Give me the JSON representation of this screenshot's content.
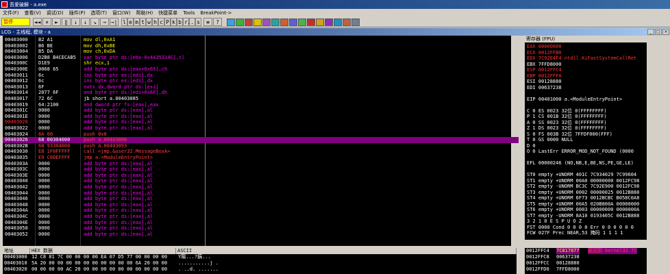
{
  "window": {
    "title": "吾爱破解 - a.exe"
  },
  "menu": [
    "文件(F)",
    "查看(V)",
    "调试(D)",
    "插件(P)",
    "选项(T)",
    "窗口(W)",
    "帮助(H)",
    "快捷菜单",
    "Tools",
    "BreakPoint->"
  ],
  "toolbar": {
    "state": "暂停",
    "nav_buttons": [
      "◄◄",
      "×",
      "►",
      "‖",
      "↓",
      "↓",
      "↘",
      "→",
      "→|"
    ],
    "letter_buttons": [
      "l",
      "e",
      "m",
      "t",
      "w",
      "h",
      "c",
      "P",
      "k",
      "b",
      "r",
      "...",
      "s"
    ],
    "misc_buttons": [
      "≡",
      "?"
    ],
    "color_buttons": [
      "#3aa0e0",
      "#40b040",
      "#c04040",
      "#e0c000",
      "#a050c0",
      "#30a0a0",
      "#d06030",
      "#6060d0",
      "#50b050",
      "#c03030",
      "#d0a020",
      "#9030b0",
      "#2090c0",
      "#c06040",
      "#708090"
    ]
  },
  "cpu_window": {
    "title": "LCG - 主线程, 模块 - a"
  },
  "colors": {
    "bg": "#000000",
    "selected_row": "#800080",
    "op_mov": "#ffff00",
    "op_arith": "#ffff00",
    "op_ptr": "#ff00ff",
    "op_call": "#ff4040",
    "red": "#ff3030"
  },
  "disasm": [
    {
      "addr": "00403000",
      "hex": "B2 A1",
      "asm": "mov dl,0xA1",
      "kind": "mov"
    },
    {
      "addr": "00403002",
      "hex": "B6 BE",
      "asm": "mov dh,0xBE",
      "kind": "mov"
    },
    {
      "addr": "00403004",
      "hex": "B5 DA",
      "asm": "mov ch,0xDA",
      "kind": "mov"
    },
    {
      "addr": "00403006",
      "hex": "D2B8 B4CECAB5",
      "asm": "sar byte ptr ds:[ebx-0x4A35314C],cl",
      "kind": "ptr"
    },
    {
      "addr": "0040300C",
      "hex": "D1E9",
      "asm": "shr ecx,1",
      "kind": "mov"
    },
    {
      "addr": "0040300E",
      "hex": "0068 65",
      "asm": "add byte ptr ds:[eax+0x65],ch",
      "kind": "ptr"
    },
    {
      "addr": "00403011",
      "hex": "6c",
      "asm": "ins byte ptr es:[edi],dx",
      "kind": "ptr"
    },
    {
      "addr": "00403012",
      "hex": "6c",
      "asm": "ins byte ptr es:[edi],dx",
      "kind": "ptr"
    },
    {
      "addr": "00403013",
      "hex": "6F",
      "asm": "outs dx,dword ptr ds:[esi]",
      "kind": "ptr"
    },
    {
      "addr": "00403014",
      "hex": "2077 6F",
      "asm": "and byte ptr ds:[edi+0x6F],dh",
      "kind": "ptr"
    },
    {
      "addr": "00403017",
      "hex": "72 6C",
      "asm": "jb short a.00403085",
      "kind": "jmp"
    },
    {
      "addr": "00403019",
      "hex": "64:2100",
      "asm": "and dword ptr fs:[eax],eax",
      "kind": "ptr"
    },
    {
      "addr": "0040301C",
      "hex": "0000",
      "asm": "add byte ptr ds:[eax],al",
      "kind": "ptr"
    },
    {
      "addr": "0040301E",
      "hex": "0000",
      "asm": "add byte ptr ds:[eax],al",
      "kind": "ptr"
    },
    {
      "addr": "00403020",
      "hex": "0000",
      "asm": "add byte ptr ds:[eax],al",
      "kind": "ptr",
      "addr_red": true
    },
    {
      "addr": "00403022",
      "hex": "0000",
      "asm": "add byte ptr ds:[eax],al",
      "kind": "ptr"
    },
    {
      "addr": "00403024",
      "hex": "6A 00",
      "asm": "push 0x0",
      "kind": "call"
    },
    {
      "addr": "00403026",
      "hex": "68 00304000",
      "asm": "push a.00403000",
      "kind": "call",
      "selected": true
    },
    {
      "addr": "0040302B",
      "hex": "68 93304000",
      "asm": "push a.00403093",
      "kind": "call"
    },
    {
      "addr": "00403030",
      "hex": "E8 1F0FFFFF",
      "asm": "call <jmp.&user32.MessageBoxA>",
      "kind": "call"
    },
    {
      "addr": "00403035",
      "hex": "E9 C6DEFFFF",
      "asm": "jmp a.<ModuleEntryPoint>",
      "kind": "call"
    },
    {
      "addr": "0040303A",
      "hex": "0000",
      "asm": "add byte ptr ds:[eax],al",
      "kind": "ptr"
    },
    {
      "addr": "0040303C",
      "hex": "0000",
      "asm": "add byte ptr ds:[eax],al",
      "kind": "ptr"
    },
    {
      "addr": "0040303E",
      "hex": "0000",
      "asm": "add byte ptr ds:[eax],al",
      "kind": "ptr"
    },
    {
      "addr": "00403040",
      "hex": "0000",
      "asm": "add byte ptr ds:[eax],al",
      "kind": "ptr"
    },
    {
      "addr": "00403042",
      "hex": "0000",
      "asm": "add byte ptr ds:[eax],al",
      "kind": "ptr"
    },
    {
      "addr": "00403044",
      "hex": "0000",
      "asm": "add byte ptr ds:[eax],al",
      "kind": "ptr"
    },
    {
      "addr": "00403046",
      "hex": "0000",
      "asm": "add byte ptr ds:[eax],al",
      "kind": "ptr"
    },
    {
      "addr": "00403048",
      "hex": "0000",
      "asm": "add byte ptr ds:[eax],al",
      "kind": "ptr"
    },
    {
      "addr": "0040304A",
      "hex": "0000",
      "asm": "add byte ptr ds:[eax],al",
      "kind": "ptr"
    },
    {
      "addr": "0040304C",
      "hex": "0000",
      "asm": "add byte ptr ds:[eax],al",
      "kind": "ptr"
    },
    {
      "addr": "0040304E",
      "hex": "0000",
      "asm": "add byte ptr ds:[eax],al",
      "kind": "ptr"
    },
    {
      "addr": "00403050",
      "hex": "0000",
      "asm": "add byte ptr ds:[eax],al",
      "kind": "ptr"
    },
    {
      "addr": "00403052",
      "hex": "0000",
      "asm": "add byte ptr ds:[eax],al",
      "kind": "ptr"
    }
  ],
  "registers": {
    "title": "寄存器 (FPU)",
    "lines": [
      {
        "t": "EAX 00000000",
        "c": "#ff3030"
      },
      {
        "t": "ECX 0012FFB0",
        "c": "#ff3030"
      },
      {
        "t": "EDX 7C92E4F4 ntdll.KiFastSystemCallRet",
        "c": "#ff3030"
      },
      {
        "t": "EBX 7FFD8000",
        "c": "#ffffff"
      },
      {
        "t": "ESP 0012FFC4",
        "c": "#ff3030"
      },
      {
        "t": "EBP 0012FFF0",
        "c": "#ff3030"
      },
      {
        "t": "ESI 00128880",
        "c": "#ffffff"
      },
      {
        "t": "EDI 00637238",
        "c": "#ffffff"
      },
      {
        "t": "",
        "c": "#ffffff"
      },
      {
        "t": "EIP 00401000 a.<ModuleEntryPoint>",
        "c": "#ffffff"
      },
      {
        "t": "",
        "c": "#ffffff"
      },
      {
        "t": "C 0  ES 0023 32位 0(FFFFFFFF)",
        "c": "#ffffff"
      },
      {
        "t": "P 1  CS 001B 32位 0(FFFFFFFF)",
        "c": "#ffffff"
      },
      {
        "t": "A 0  SS 0023 32位 0(FFFFFFFF)",
        "c": "#ffffff"
      },
      {
        "t": "Z 1  DS 0023 32位 0(FFFFFFFF)",
        "c": "#ffffff"
      },
      {
        "t": "S 0  FS 003B 32位 7FFDF000(FFF)",
        "c": "#ffffff"
      },
      {
        "t": "T 0  GS 0000 NULL",
        "c": "#ffffff"
      },
      {
        "t": "D 0",
        "c": "#ffffff"
      },
      {
        "t": "O 0  LastErr ERROR_MOD_NOT_FOUND (0000",
        "c": "#ffffff"
      },
      {
        "t": "",
        "c": "#ffffff"
      },
      {
        "t": "EFL 00000246 (NO,NB,E,BE,NS,PE,GE,LE)",
        "c": "#ffffff"
      },
      {
        "t": "",
        "c": "#ffffff"
      },
      {
        "t": "ST0 empty +UNORM 401C 7C934029 7C99604",
        "c": "#ffffff"
      },
      {
        "t": "ST1 empty +UNORM 00A0 00000000 0012FC98",
        "c": "#ffffff"
      },
      {
        "t": "ST2 empty -UNORM BC3C 7C92E900 0012FC98",
        "c": "#ffffff"
      },
      {
        "t": "ST3 empty +UNORM 0002 00000025 0012B888",
        "c": "#ffffff"
      },
      {
        "t": "ST4 empty +UNORM 6F73 0012BCBC B058C0A8",
        "c": "#ffffff"
      },
      {
        "t": "ST5 empty +UNORM 00A5 020B800A 00000000",
        "c": "#ffffff"
      },
      {
        "t": "ST6 empty +UNORM 0003 00000000 0000000A",
        "c": "#ffffff"
      },
      {
        "t": "ST7 empty -UNORM 8A10 0193405C 0012B888",
        "c": "#ffffff"
      },
      {
        "t": "               3 2 1 0     E S P U O Z",
        "c": "#ffffff"
      },
      {
        "t": "FST 0000  Cond 0 0 0 0  Err 0 0 0 0 0 0",
        "c": "#ffffff"
      },
      {
        "t": "FCW 027F  Prec NEAR,53  掩码   1 1 1 1",
        "c": "#ffffff"
      }
    ]
  },
  "dump": {
    "headers": [
      "地址",
      "HEX 数据",
      "ASCII"
    ],
    "rows": [
      {
        "addr": "00403000",
        "hex": "12 C8 81 7C 00 00 00 00 EA 07 D5 77 00 00 00 00",
        "ascii": "Ÿ陽...?鎬..."
      },
      {
        "addr": "00403010",
        "hex": "5A 20 00 00 00 00 00 00 00 00 00 00 6A 20 00 00",
        "ascii": "...........j ."
      },
      {
        "addr": "00403020",
        "hex": "00 00 00 00 AC 20 00 00 00 00 00 00 00 00 00 00",
        "ascii": ". ..d. ......."
      }
    ]
  },
  "stack": {
    "rows": [
      {
        "addr": "0012FFC4",
        "val": "7C817077",
        "comment": "返回到 kernel32.7C",
        "sel": true
      },
      {
        "addr": "0012FFC8",
        "val": "00637238",
        "comment": "",
        "sel": false
      },
      {
        "addr": "0012FFCC",
        "val": "00128880",
        "comment": "",
        "sel": false
      },
      {
        "addr": "0012FFD0",
        "val": "7FFD8000",
        "comment": "",
        "sel": false
      }
    ]
  }
}
